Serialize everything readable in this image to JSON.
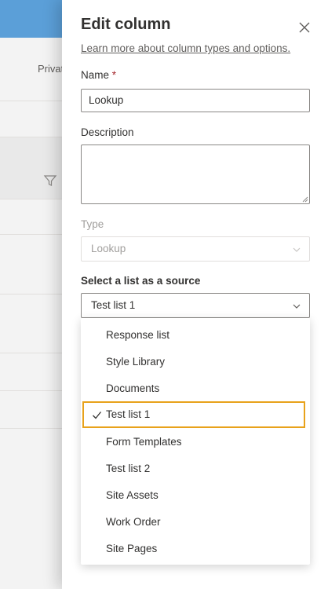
{
  "background": {
    "privacy_text": "Privat"
  },
  "panel": {
    "title": "Edit column",
    "learn_link": "Learn more about column types and options.",
    "name": {
      "label": "Name",
      "required_mark": "*",
      "value": "Lookup"
    },
    "description": {
      "label": "Description",
      "value": ""
    },
    "type": {
      "label": "Type",
      "value": "Lookup",
      "disabled": true
    },
    "source": {
      "label": "Select a list as a source",
      "value": "Test list 1",
      "options": [
        "Response list",
        "Style Library",
        "Documents",
        "Test list 1",
        "Form Templates",
        "Test list 2",
        "Site Assets",
        "Work Order",
        "Site Pages"
      ],
      "selected_index": 3
    }
  },
  "colors": {
    "accent_blue": "#5b9fd8",
    "selection_border": "#e8a21b",
    "required": "#a4262c"
  }
}
